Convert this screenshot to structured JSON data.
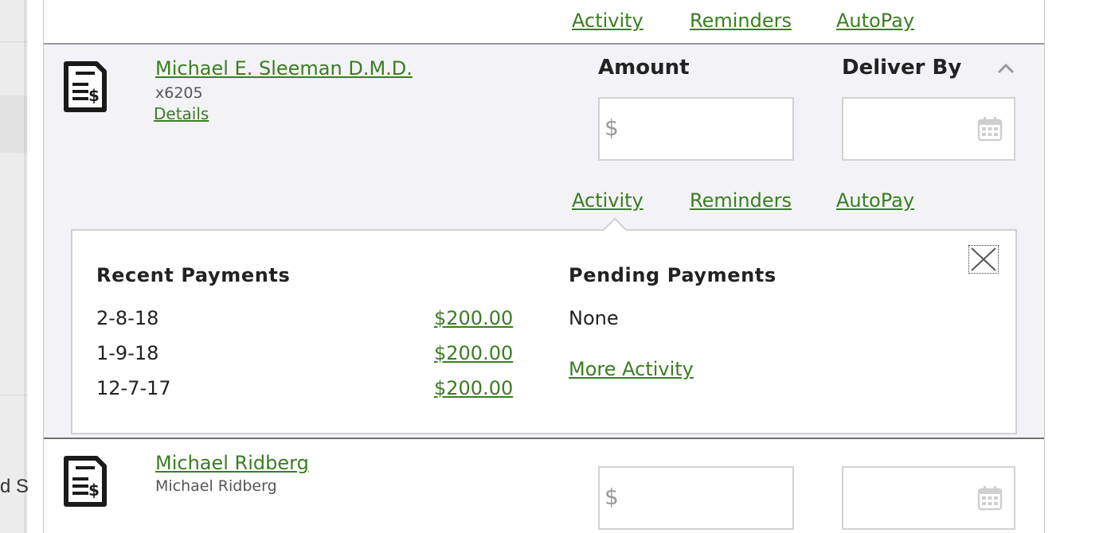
{
  "background": {
    "partial_text": "d S"
  },
  "top_links": {
    "activity": "Activity",
    "reminders": "Reminders",
    "autopay": "AutoPay"
  },
  "payee1": {
    "name": "Michael E. Sleeman D.M.D.",
    "account": "x6205",
    "details_label": "Details",
    "amount_header": "Amount",
    "deliver_by_header": "Deliver By",
    "currency_symbol": "$",
    "amount_value": "",
    "deliver_by_value": "",
    "links": {
      "activity": "Activity",
      "reminders": "Reminders",
      "autopay": "AutoPay"
    },
    "activity_panel": {
      "recent_title": "Recent Payments",
      "recent_payments": [
        {
          "date": "2-8-18",
          "amount": "$200.00"
        },
        {
          "date": "1-9-18",
          "amount": "$200.00"
        },
        {
          "date": "12-7-17",
          "amount": "$200.00"
        }
      ],
      "pending_title": "Pending Payments",
      "pending_none": "None",
      "more_activity": "More Activity"
    }
  },
  "payee2": {
    "name": "Michael Ridberg",
    "subtitle": "Michael Ridberg",
    "currency_symbol": "$",
    "amount_value": "",
    "deliver_by_value": ""
  },
  "colors": {
    "link_green": "#3b7d23",
    "expanded_bg": "#f3f3f7",
    "border_gray": "#d2d2d2"
  }
}
